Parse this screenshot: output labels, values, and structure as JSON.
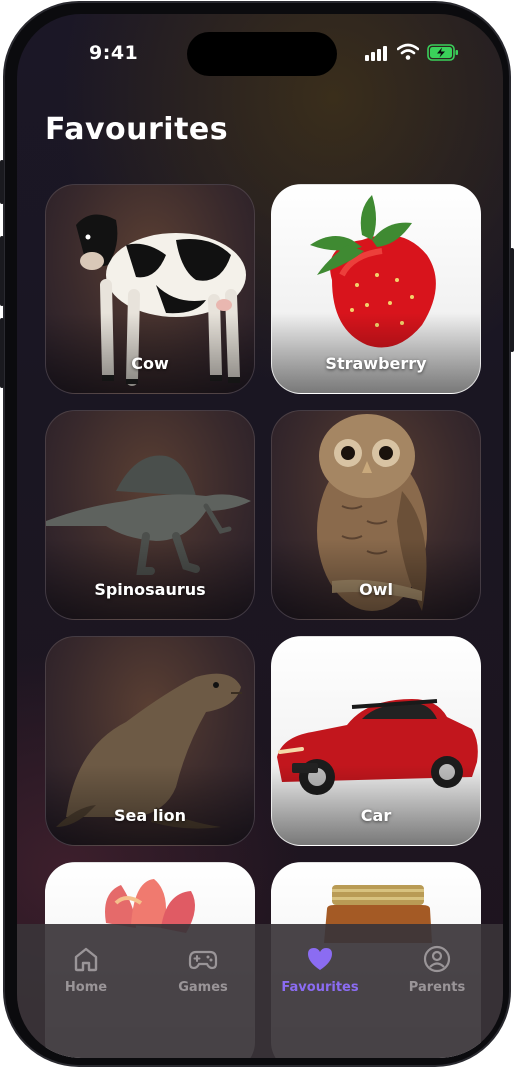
{
  "status_bar": {
    "time": "9:41",
    "icons": [
      "signal-icon",
      "wifi-icon",
      "battery-charging-icon"
    ]
  },
  "page": {
    "title": "Favourites"
  },
  "cards": [
    {
      "label": "Cow",
      "icon": "cow-image"
    },
    {
      "label": "Strawberry",
      "icon": "strawberry-image"
    },
    {
      "label": "Spinosaurus",
      "icon": "spinosaurus-image"
    },
    {
      "label": "Owl",
      "icon": "owl-image"
    },
    {
      "label": "Sea lion",
      "icon": "sea-lion-image"
    },
    {
      "label": "Car",
      "icon": "car-image"
    },
    {
      "label": "",
      "icon": "flower-image"
    },
    {
      "label": "",
      "icon": "jar-image"
    }
  ],
  "tabbar": {
    "items": [
      {
        "label": "Home",
        "icon": "home-icon"
      },
      {
        "label": "Games",
        "icon": "gamepad-icon"
      },
      {
        "label": "Favourites",
        "icon": "heart-icon",
        "active": true
      },
      {
        "label": "Parents",
        "icon": "user-circle-icon"
      }
    ],
    "active_color": "#8b6cf2",
    "inactive_color": "#9a9598"
  }
}
